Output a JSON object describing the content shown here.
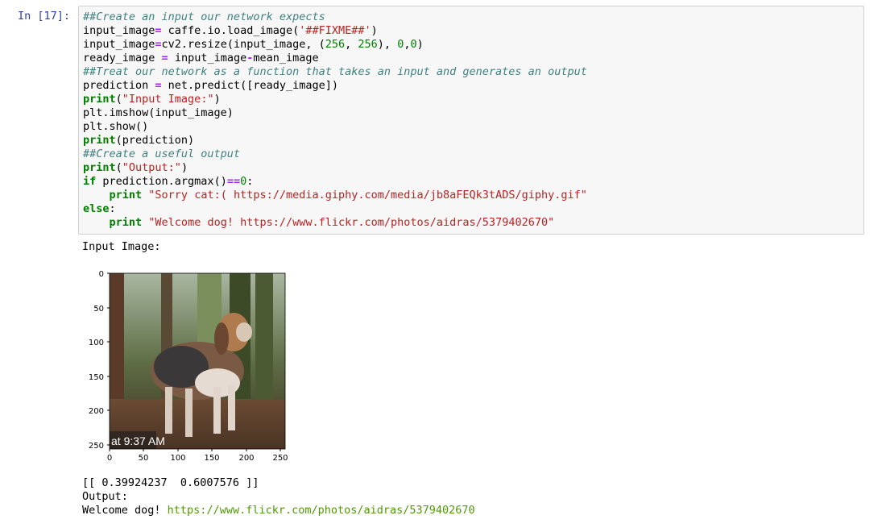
{
  "cell": {
    "prompt": "In [17]:",
    "code_lines": [
      "##Create an input our network expects",
      "input_image= caffe.io.load_image('##FIXME##')",
      "input_image=cv2.resize(input_image, (256, 256), 0,0)",
      "ready_image = input_image-mean_image",
      "##Treat our network as a function that takes an input and generates an output",
      "prediction = net.predict([ready_image])",
      "print(\"Input Image:\")",
      "plt.imshow(input_image)",
      "plt.show()",
      "print(prediction)",
      "##Create a useful output",
      "print(\"Output:\")",
      "if prediction.argmax()==0:",
      "    print \"Sorry cat:( https://media.giphy.com/media/jb8aFEQk3tADS/giphy.gif\"",
      "else:",
      "    print \"Welcome dog! https://www.flickr.com/photos/aidras/5379402670\""
    ]
  },
  "output": {
    "input_image_label": "Input Image:",
    "prediction_text": "[[ 0.39924237  0.6007576 ]]",
    "output_label": "Output:",
    "welcome_prefix": "Welcome dog! ",
    "welcome_link": "https://www.flickr.com/photos/aidras/5379402670"
  },
  "figure": {
    "x_ticks": [
      "0",
      "50",
      "100",
      "150",
      "200",
      "250"
    ],
    "y_ticks": [
      "0",
      "50",
      "100",
      "150",
      "200",
      "250"
    ],
    "image_overlay_text": "at 9:37 AM"
  }
}
